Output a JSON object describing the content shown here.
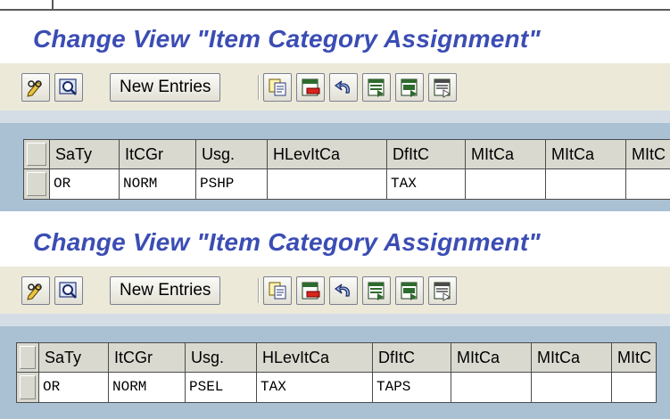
{
  "screens": [
    {
      "title": "Change View \"Item Category Assignment\"",
      "toolbar": {
        "new_entries_label": "New Entries"
      },
      "table": {
        "headers": [
          "SaTy",
          "ItCGr",
          "Usg.",
          "HLevItCa",
          "DfItC",
          "MItCa",
          "MItCa",
          "MItC"
        ],
        "row": [
          "OR",
          "NORM",
          "PSHP",
          "",
          "TAX",
          "",
          "",
          ""
        ]
      }
    },
    {
      "title": "Change View \"Item Category Assignment\"",
      "toolbar": {
        "new_entries_label": "New Entries"
      },
      "table": {
        "headers": [
          "SaTy",
          "ItCGr",
          "Usg.",
          "HLevItCa",
          "DfItC",
          "MItCa",
          "MItCa",
          "MItC"
        ],
        "row": [
          "OR",
          "NORM",
          "PSEL",
          "TAX",
          "TAPS",
          "",
          "",
          ""
        ]
      }
    }
  ],
  "icons": [
    "pencil-glasses-icon",
    "display-change-icon",
    "copy-icon",
    "delete-icon",
    "undo-icon",
    "select-all-icon",
    "select-block-icon",
    "deselect-all-icon"
  ],
  "colors": {
    "title": "#3b4db4",
    "toolbar_bg": "#ece9d8",
    "table_area_bg": "#a9c1d3",
    "header_bg": "#d9d9d0"
  }
}
